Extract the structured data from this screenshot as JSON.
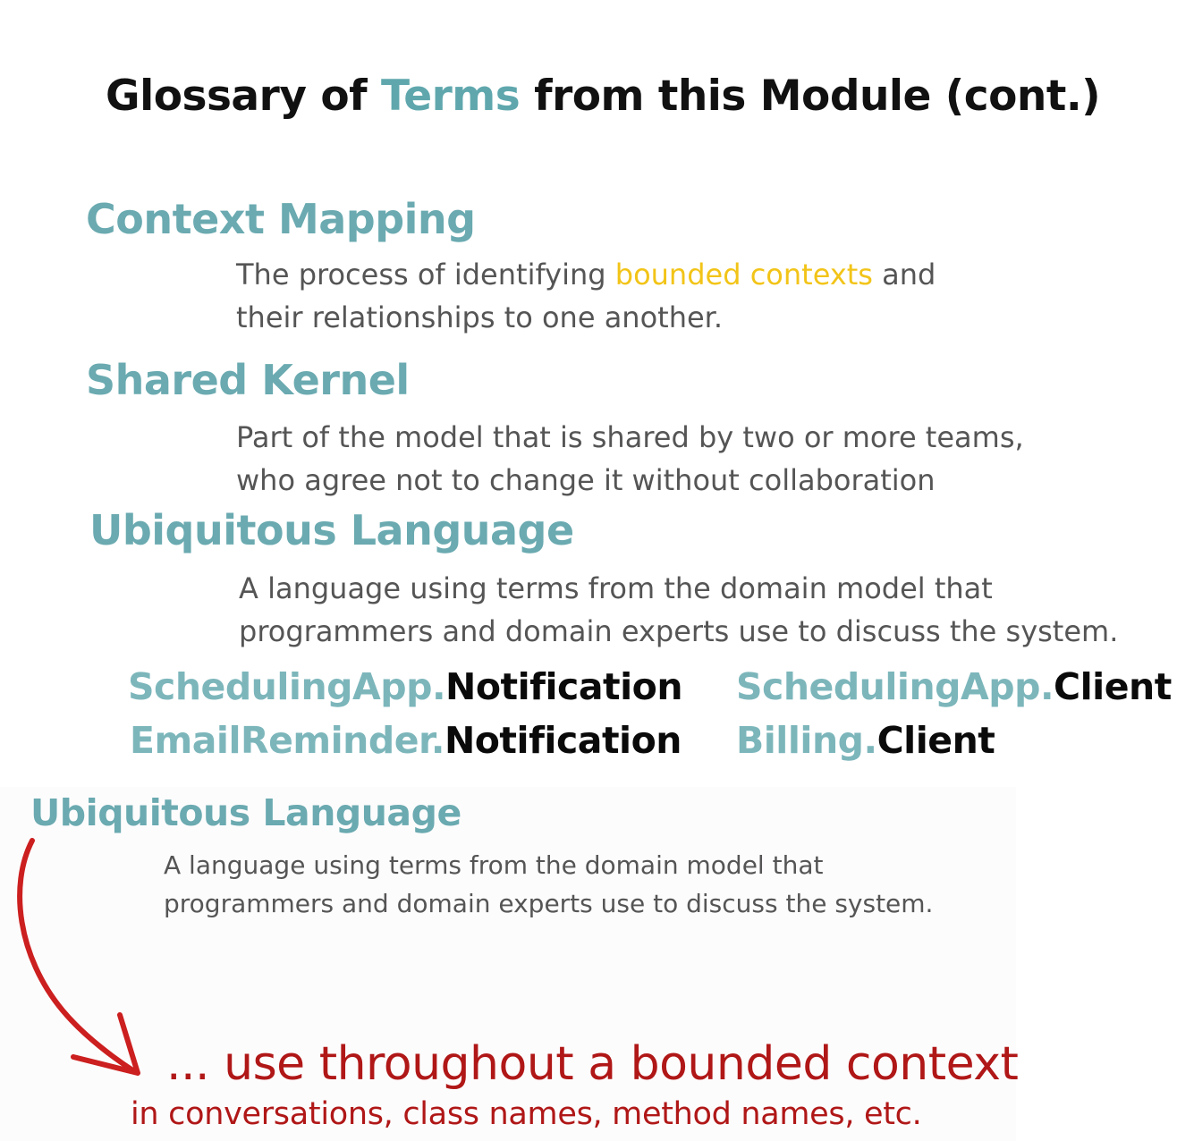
{
  "title": {
    "part1": "Glossary of ",
    "highlight": "Terms",
    "part2": " from this Module (cont.)"
  },
  "terms": [
    {
      "term": "Context Mapping",
      "def_line1_pre": "The process of identifying ",
      "def_line1_highlight": "bounded contexts",
      "def_line1_post": " and",
      "def_line2": "their relationships to one another."
    },
    {
      "term": "Shared Kernel",
      "def_line1": "Part of the model that is shared by two or more teams,",
      "def_line2": "who agree not to change it without collaboration"
    },
    {
      "term": "Ubiquitous Language",
      "def_line1": "A language using terms from the domain model that",
      "def_line2": "programmers and domain experts use to discuss the system."
    }
  ],
  "examples": [
    {
      "ns": "SchedulingApp.",
      "cls": "Notification"
    },
    {
      "ns": "EmailReminder.",
      "cls": "Notification"
    },
    {
      "ns": "SchedulingApp.",
      "cls": "Client"
    },
    {
      "ns": "Billing.",
      "cls": "Client"
    }
  ],
  "overlay": {
    "term": "Ubiquitous Language",
    "def_line1": "A language using terms from the domain model that",
    "def_line2": "programmers and domain experts use to discuss the system.",
    "callout_main": "... use throughout a bounded context",
    "callout_sub": "in conversations, class names, method names, etc."
  },
  "colors": {
    "term": "#6aaab0",
    "highlight_yellow": "#f2c418",
    "callout_red": "#b01717",
    "arrow": "#cc1f1f"
  },
  "icons": {
    "arrow": "curved-arrow-icon"
  }
}
